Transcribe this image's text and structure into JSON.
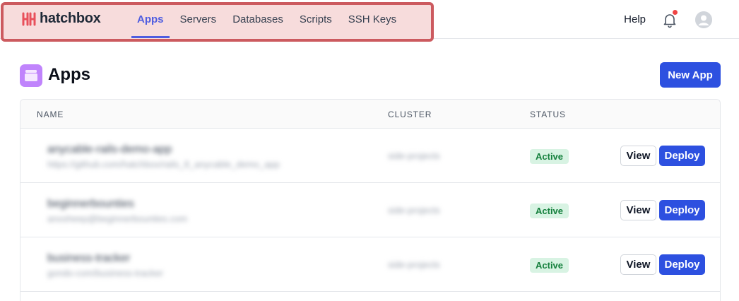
{
  "brand": {
    "name": "hatchbox",
    "color": "#e8505b"
  },
  "nav": {
    "items": [
      {
        "label": "Apps",
        "active": true
      },
      {
        "label": "Servers"
      },
      {
        "label": "Databases"
      },
      {
        "label": "Scripts"
      },
      {
        "label": "SSH Keys"
      }
    ],
    "help_label": "Help",
    "bell_icon": "bell-icon",
    "has_notification": true
  },
  "page": {
    "title": "Apps",
    "icon": "apps-icon",
    "new_button_label": "New App"
  },
  "table": {
    "columns": [
      "NAME",
      "CLUSTER",
      "STATUS"
    ],
    "rows": [
      {
        "name": "anycable-rails-demo-app",
        "subtitle": "https://github.com/hatchbox/rails_8_anycable_demo_app",
        "cluster": "side-projects",
        "status": "Active",
        "view_label": "View",
        "deploy_label": "Deploy"
      },
      {
        "name": "beginnerbounties",
        "subtitle": "anosheep@beginnerbounties.com",
        "cluster": "side-projects",
        "status": "Active",
        "view_label": "View",
        "deploy_label": "Deploy"
      },
      {
        "name": "business-tracker",
        "subtitle": "gondo-com/business-tracker",
        "cluster": "side-projects",
        "status": "Active",
        "view_label": "View",
        "deploy_label": "Deploy"
      }
    ]
  },
  "colors": {
    "accent": "#2d50e0",
    "nav_active": "#4f5de0",
    "status_active_bg": "#d8f3e3",
    "status_active_text": "#15803d",
    "highlight_border": "#cc5a5f",
    "highlight_fill": "#f7dcdc"
  }
}
